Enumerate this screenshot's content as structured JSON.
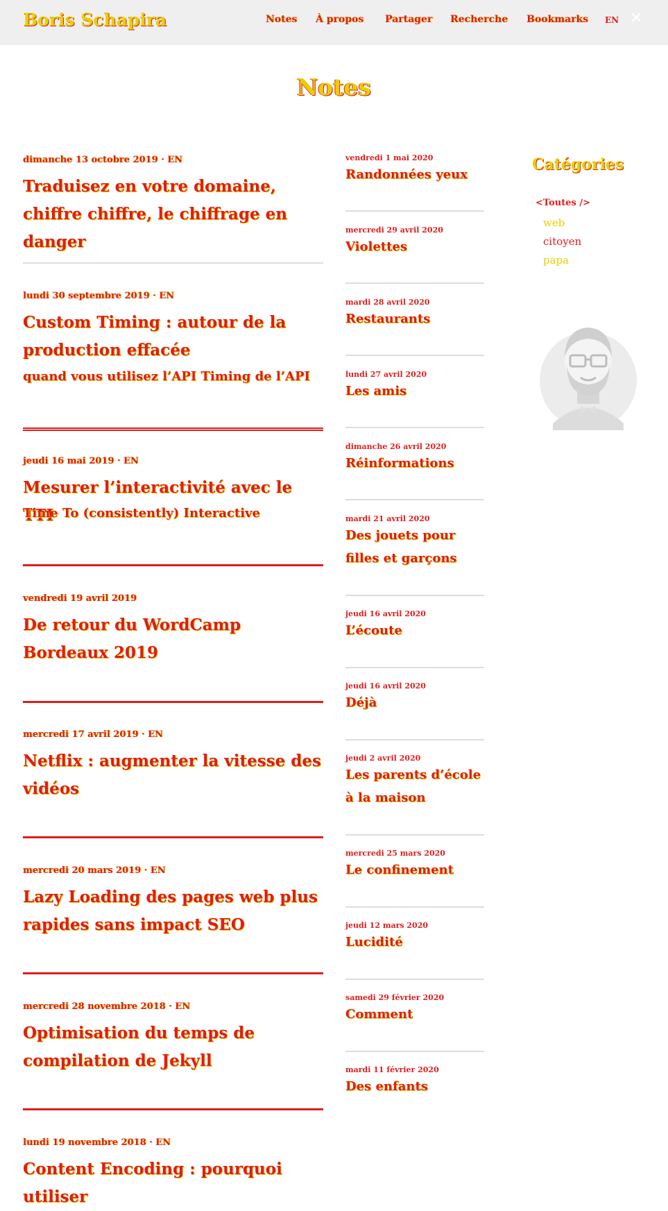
{
  "header": {
    "brand": "Boris Schapira",
    "nav": [
      "Notes",
      "À propos",
      "Partager",
      "Recherche",
      "Bookmarks"
    ],
    "lang": "EN",
    "close_icon": "close-icon"
  },
  "page_title": "Notes",
  "notes": [
    {
      "date": "dimanche 13 octobre 2019 · EN",
      "title": "Traduisez en votre domaine, chiffre chiffre, le chiffrage en danger",
      "subtitle": ""
    },
    {
      "date": "lundi 30 septembre 2019 · EN",
      "title": "Custom Timing : autour de la production effacée",
      "subtitle": "quand vous utilisez l’API Timing de l’API"
    },
    {
      "date": "jeudi 16 mai 2019 · EN",
      "title": "Mesurer l’interactivité avec le TTI",
      "subtitle": "Time To (consistently) Interactive"
    },
    {
      "date": "vendredi 19 avril 2019",
      "title": "De retour du WordCamp Bordeaux 2019",
      "subtitle": ""
    },
    {
      "date": "mercredi 17 avril 2019 · EN",
      "title": "Netflix : augmenter la vitesse des vidéos",
      "subtitle": ""
    },
    {
      "date": "mercredi 20 mars 2019 · EN",
      "title": "Lazy Loading des pages web plus rapides sans impact SEO",
      "subtitle": ""
    },
    {
      "date": "mercredi 28 novembre 2018 · EN",
      "title": "Optimisation du temps de compilation de Jekyll",
      "subtitle": ""
    },
    {
      "date": "lundi 19 novembre 2018 · EN",
      "title": "Content Encoding : pourquoi utiliser",
      "subtitle": ""
    }
  ],
  "mid_notes": [
    {
      "date": "vendredi 1 mai 2020",
      "title": "Randonnées yeux"
    },
    {
      "date": "mercredi 29 avril 2020",
      "title": "Violettes"
    },
    {
      "date": "mardi 28 avril 2020",
      "title": "Restaurants"
    },
    {
      "date": "lundi 27 avril 2020",
      "title": "Les amis"
    },
    {
      "date": "dimanche 26 avril 2020",
      "title": "Réinformations"
    },
    {
      "date": "mardi 21 avril 2020",
      "title": "Des jouets pour filles et garçons"
    },
    {
      "date": "jeudi 16 avril 2020",
      "title": "L’écoute"
    },
    {
      "date": "jeudi 16 avril 2020",
      "title": "Déjà"
    },
    {
      "date": "jeudi 2 avril 2020",
      "title": "Les parents d’école à la maison"
    },
    {
      "date": "mercredi 25 mars 2020",
      "title": "Le confinement"
    },
    {
      "date": "jeudi 12 mars 2020",
      "title": "Lucidité"
    },
    {
      "date": "samedi 29 février 2020",
      "title": "Comment"
    },
    {
      "date": "mardi 11 février 2020",
      "title": "Des enfants"
    }
  ],
  "categories": {
    "title": "Catégories",
    "all": "<Toutes />",
    "items": [
      "web",
      "citoyen",
      "papa"
    ]
  },
  "icons": {
    "avatar": "avatar-illustration"
  },
  "colors": {
    "primary": "#e01c1c",
    "accent": "#e8d000"
  }
}
